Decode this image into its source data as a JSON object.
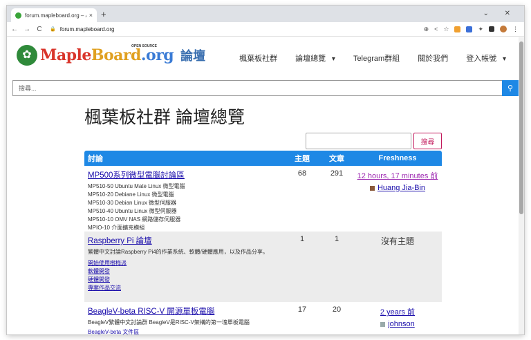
{
  "browser": {
    "tab_title": "forum.mapleboard.org – Ā",
    "tab_close": "×",
    "new_tab": "+",
    "window_controls": "⌄ ✕",
    "url": "forum.mapleboard.org",
    "nav_back": "←",
    "nav_forward": "→",
    "nav_reload": "C",
    "toolbar_icons": [
      "⊕",
      "<",
      "☆"
    ],
    "menu_icon": "⋮"
  },
  "site": {
    "logo_text_parts": [
      "Maple",
      "Board",
      ".org"
    ],
    "logo_opensource": "OPEN SOURCE",
    "logo_suffix": "論壇",
    "nav": [
      {
        "label": "楓葉板社群",
        "dropdown": false
      },
      {
        "label": "論壇總覽",
        "dropdown": true
      },
      {
        "label": "Telegram群組",
        "dropdown": false
      },
      {
        "label": "關於我們",
        "dropdown": false
      },
      {
        "label": "登入帳號",
        "dropdown": true
      }
    ],
    "search_placeholder": "搜尋...",
    "search_icon": "search-icon"
  },
  "main": {
    "page_title": "楓葉板社群 論壇總覽",
    "forum_search_button": "搜尋",
    "table": {
      "headers": {
        "forum": "討論",
        "topics": "主題",
        "posts": "文章",
        "freshness": "Freshness"
      },
      "rows": [
        {
          "title": "MP500系列微型電腦討論區",
          "desc_lines": [
            "MP510-50 Ubuntu Mate Linux 微型電腦",
            "MP510-20 Debiane Linux 微型電腦",
            "MP510-30 Debian Linux 微型伺服器",
            "MP510-40 Ubuntu Linux 微型伺服器",
            "MP510-10 OMV NAS 網路儲存伺服器",
            "MPIO-10 介面擴充模組"
          ],
          "sublinks": [],
          "topics": "68",
          "posts": "291",
          "freshness": "12 hours, 17 minutes 前",
          "author": "Huang Jia-Bin"
        },
        {
          "title": "Raspberry Pi 論壇",
          "desc_lines": [
            "繁體中文討論Raspberry Pi4的作業系統、軟體/硬體應用，以及作品分享。"
          ],
          "sublinks": [
            "開始使用樹梅派",
            "軟體開發",
            "硬體開發",
            "專案作品交流"
          ],
          "topics": "1",
          "posts": "1",
          "freshness": "沒有主題",
          "author": ""
        },
        {
          "title": "BeagleV-beta RISC-V 開源單板電腦",
          "desc_lines": [
            "BeagleV繁體中文討論群 BeagleV是RISC-V架構的第一塊單板電腦"
          ],
          "sublinks": [
            "BeagleV-beta 文件區"
          ],
          "topics": "17",
          "posts": "20",
          "freshness": "2 years 前",
          "author": "johnson"
        }
      ]
    }
  }
}
